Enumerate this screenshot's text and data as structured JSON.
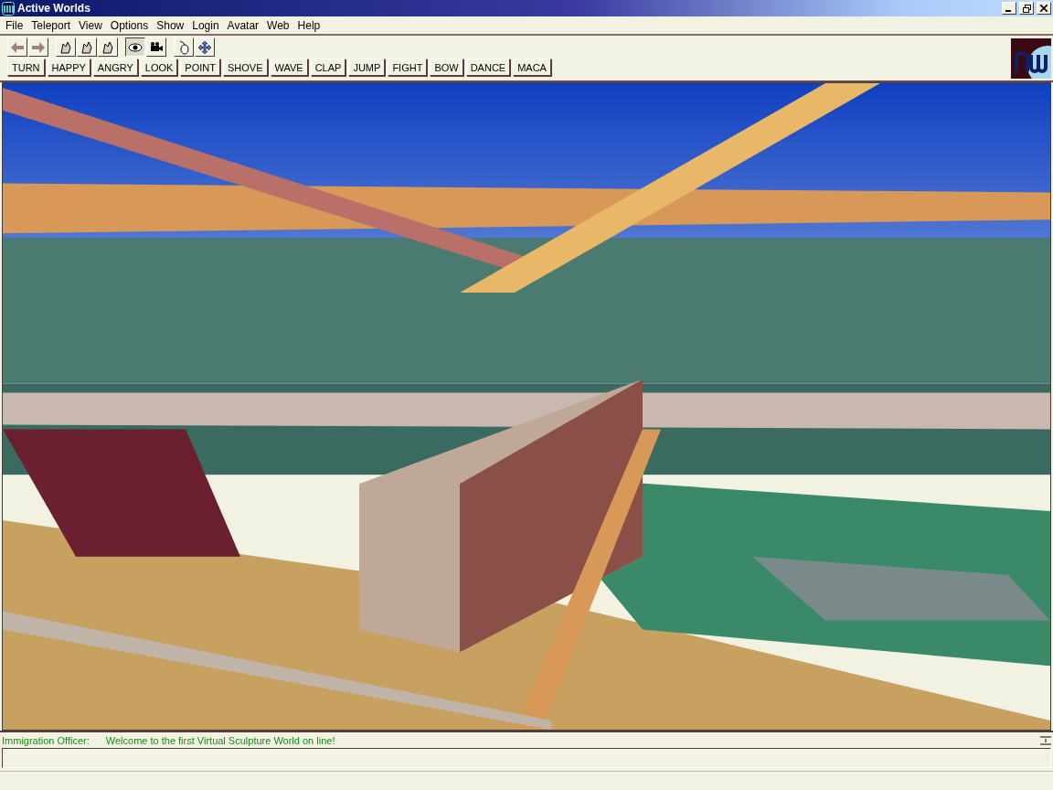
{
  "window": {
    "title": "Active Worlds"
  },
  "menu": [
    "File",
    "Teleport",
    "View",
    "Options",
    "Show",
    "Login",
    "Avatar",
    "Web",
    "Help"
  ],
  "view_modes": [
    {
      "selected": true
    },
    {
      "selected": false
    }
  ],
  "gestures": [
    "TURN",
    "HAPPY",
    "ANGRY",
    "LOOK",
    "POINT",
    "SHOVE",
    "WAVE",
    "CLAP",
    "JUMP",
    "FIGHT",
    "BOW",
    "DANCE",
    "MACA"
  ],
  "chat": {
    "speaker": "Immigration Officer:",
    "message": "Welcome to the first Virtual Sculpture World on line!"
  }
}
